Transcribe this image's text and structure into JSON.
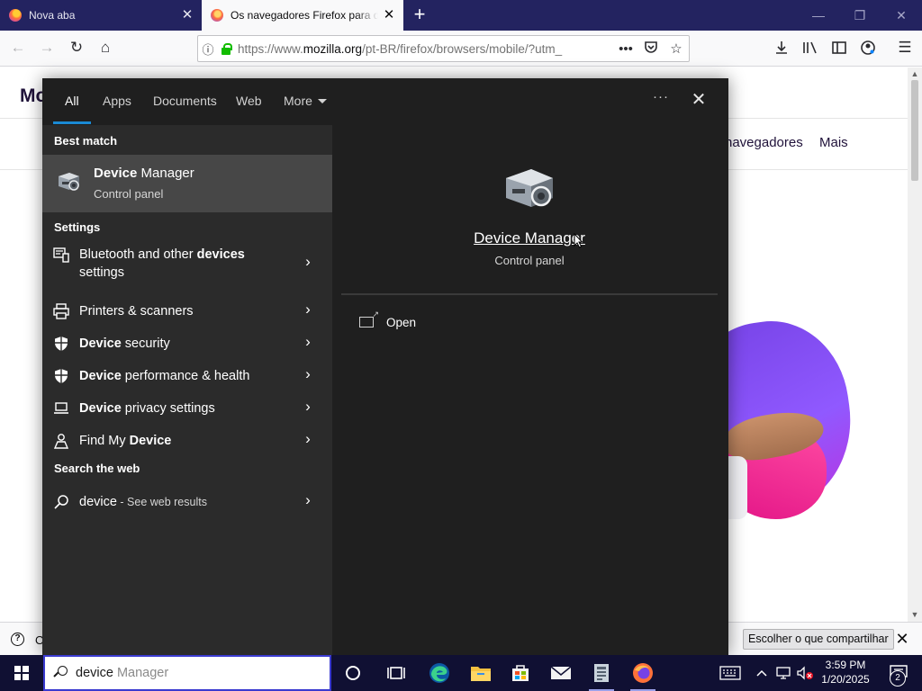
{
  "browser": {
    "tabs": [
      {
        "title": "Nova aba"
      },
      {
        "title": "Os navegadores Firefox para dispositivos móveis"
      }
    ],
    "url": {
      "prefix": "https://www.",
      "domain": "mozilla.org",
      "path": "/pt-BR/firefox/browsers/mobile/?utm_"
    }
  },
  "page": {
    "logo_fragment": "Mo",
    "nav": [
      {
        "label": "navegadores"
      },
      {
        "label": "Mais"
      }
    ]
  },
  "notification": {
    "fragment": "O",
    "share_button": "Escolher o que compartilhar"
  },
  "search_panel": {
    "tabs": [
      {
        "label": "All",
        "active": true
      },
      {
        "label": "Apps"
      },
      {
        "label": "Documents"
      },
      {
        "label": "Web"
      },
      {
        "label": "More"
      }
    ],
    "best_match": {
      "heading": "Best match",
      "name_bold": "Device",
      "name_rest": " Manager",
      "subtitle": "Control panel"
    },
    "settings": {
      "heading": "Settings",
      "items": [
        {
          "pre": "Bluetooth and other ",
          "bold": "devices",
          "post": " settings",
          "icon": "bluetooth-devices-icon"
        },
        {
          "pre": "Printers & scanners",
          "bold": "",
          "post": "",
          "icon": "printer-icon"
        },
        {
          "pre": "",
          "bold": "Device",
          "post": " security",
          "icon": "shield-icon"
        },
        {
          "pre": "",
          "bold": "Device",
          "post": " performance & health",
          "icon": "shield-icon"
        },
        {
          "pre": "",
          "bold": "Device",
          "post": " privacy settings",
          "icon": "laptop-privacy-icon"
        },
        {
          "pre": "Find My ",
          "bold": "Device",
          "post": "",
          "icon": "person-location-icon"
        }
      ]
    },
    "web": {
      "heading": "Search the web",
      "query": "device",
      "suffix": " - See web results"
    },
    "preview": {
      "name": "Device Manager",
      "subtitle": "Control panel",
      "actions": [
        {
          "label": "Open"
        }
      ]
    }
  },
  "taskbar": {
    "search_typed": "device",
    "search_ghost": " Manager",
    "time": "3:59 PM",
    "date": "1/20/2025",
    "notification_count": "2"
  }
}
